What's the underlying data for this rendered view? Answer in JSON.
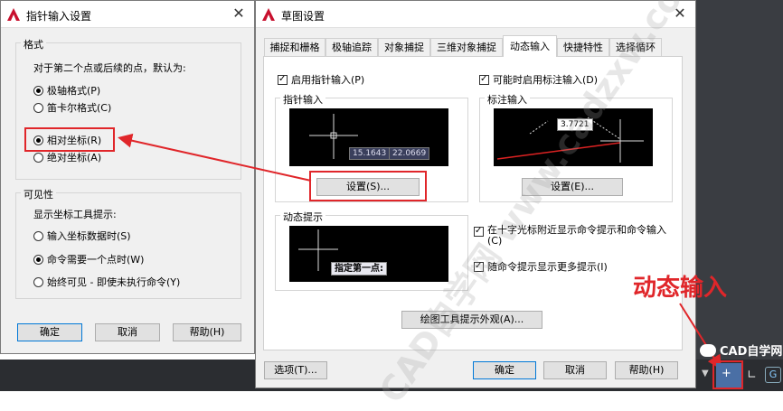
{
  "pointer_dialog": {
    "title": "指针输入设置",
    "format_group": "格式",
    "format_prompt": "对于第二个点或后续的点，默认为:",
    "opt_polar": "极轴格式(P)",
    "opt_cartesian": "笛卡尔格式(C)",
    "opt_relative": "相对坐标(R)",
    "opt_absolute": "绝对坐标(A)",
    "visibility_group": "可见性",
    "visibility_prompt": "显示坐标工具提示:",
    "vis_typing": "输入坐标数据时(S)",
    "vis_command": "命令需要一个点时(W)",
    "vis_always": "始终可见 - 即使未执行命令(Y)",
    "ok": "确定",
    "cancel": "取消",
    "help": "帮助(H)"
  },
  "draft_dialog": {
    "title": "草图设置",
    "tabs": [
      "捕捉和栅格",
      "极轴追踪",
      "对象捕捉",
      "三维对象捕捉",
      "动态输入",
      "快捷特性",
      "选择循环"
    ],
    "enable_pointer": "启用指针输入(P)",
    "enable_dim": "可能时启用标注输入(D)",
    "pointer_group": "指针输入",
    "dim_group": "标注输入",
    "pointer_preview_x": "15.1643",
    "pointer_preview_y": "22.0669",
    "dim_preview_value": "3.7721",
    "settings_s": "设置(S)...",
    "settings_e": "设置(E)...",
    "dyn_group": "动态提示",
    "dyn_preview_text": "指定第一点:",
    "show_near_cross": "在十字光标附近显示命令提示和命令输入(C)",
    "show_more": "随命令提示显示更多提示(I)",
    "tooltip_appearance": "绘图工具提示外观(A)...",
    "options": "选项(T)...",
    "ok": "确定",
    "cancel": "取消",
    "help": "帮助(H)"
  },
  "annotation": "动态输入",
  "watermark_text": "CAD自学网 www.cadzxw.com",
  "brand_badge": "CAD自学网",
  "colors": {
    "accent_red": "#e0262a",
    "autocad_red": "#c8102e",
    "dark_bg": "#2b2d31"
  }
}
